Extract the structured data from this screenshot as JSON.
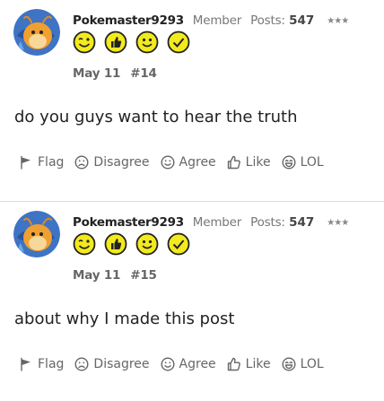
{
  "posts": [
    {
      "username": "Pokemaster9293",
      "role": "Member",
      "posts_label": "Posts:",
      "post_count": "547",
      "stars": "★★★",
      "date": "May 11",
      "post_number": "#14",
      "body": "do you guys want to hear the truth",
      "actions": {
        "flag": "Flag",
        "disagree": "Disagree",
        "agree": "Agree",
        "like": "Like",
        "lol": "LOL"
      }
    },
    {
      "username": "Pokemaster9293",
      "role": "Member",
      "posts_label": "Posts:",
      "post_count": "547",
      "stars": "★★★",
      "date": "May 11",
      "post_number": "#15",
      "body": "about why I made this post",
      "actions": {
        "flag": "Flag",
        "disagree": "Disagree",
        "agree": "Agree",
        "like": "Like",
        "lol": "LOL"
      }
    }
  ],
  "badge_icons": [
    "wink-face-icon",
    "thumbs-up-icon",
    "smile-face-icon",
    "checkmark-icon"
  ],
  "colors": {
    "badge_yellow": "#f2ea1c",
    "avatar_blue": "#3f73c4",
    "avatar_orange": "#f0a030"
  }
}
